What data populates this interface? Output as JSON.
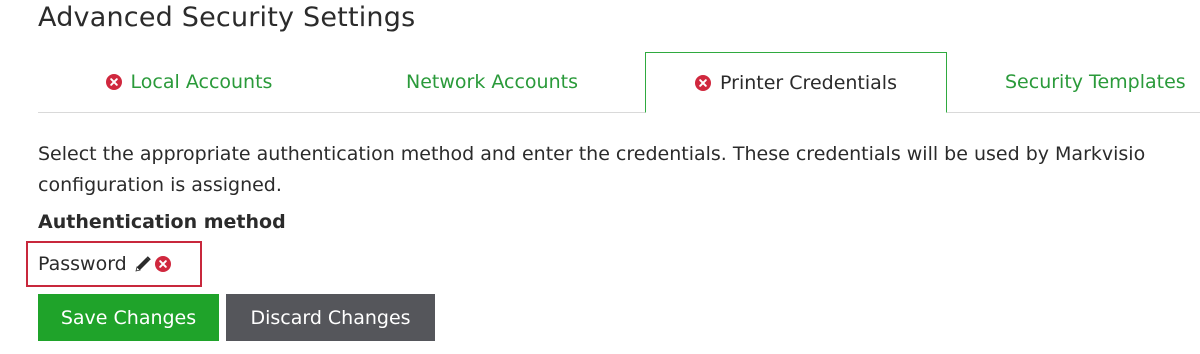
{
  "page_title": "Advanced Security Settings",
  "tabs": [
    {
      "label": "Local Accounts",
      "has_error": true,
      "active": false
    },
    {
      "label": "Network Accounts",
      "has_error": false,
      "active": false
    },
    {
      "label": "Printer Credentials",
      "has_error": true,
      "active": true
    },
    {
      "label": "Security Templates",
      "has_error": false,
      "active": false
    }
  ],
  "description": {
    "line1": "Select the appropriate authentication method and enter the credentials. These credentials will be used by Markvisio",
    "line2": "configuration is assigned."
  },
  "auth_method": {
    "label": "Authentication method",
    "value": "Password",
    "edit_icon": "pencil-icon",
    "clear_icon": "error-circle-icon"
  },
  "buttons": {
    "save_label": "Save Changes",
    "discard_label": "Discard Changes"
  },
  "colors": {
    "tab_text": "#2a9a3a",
    "active_tab_border": "#2faa3f",
    "error_red": "#d0283e",
    "save_button": "#1fa32a",
    "discard_button": "#55565b",
    "highlight_border": "#c8283c"
  }
}
